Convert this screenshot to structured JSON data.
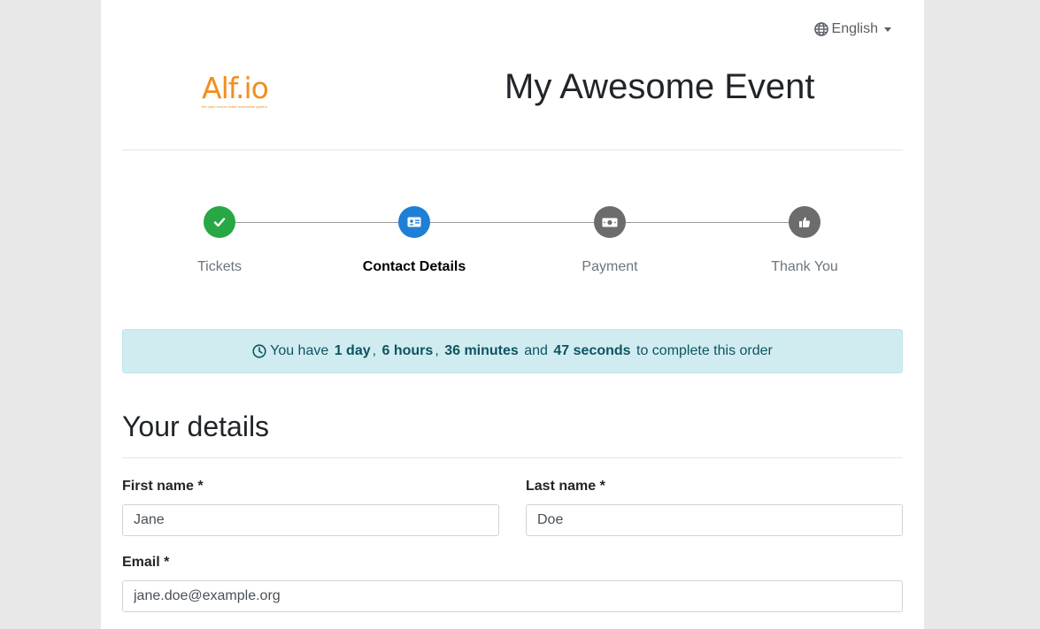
{
  "language": {
    "icon": "globe-icon",
    "label": "English"
  },
  "logo": {
    "text": "Alf.io",
    "tagline": "the open source ticket reservation system",
    "color": "#f28e1e"
  },
  "event": {
    "title": "My Awesome Event"
  },
  "steps": [
    {
      "label": "Tickets",
      "state": "done",
      "icon": "check-icon"
    },
    {
      "label": "Contact Details",
      "state": "active",
      "icon": "id-card-icon"
    },
    {
      "label": "Payment",
      "state": "todo",
      "icon": "money-icon"
    },
    {
      "label": "Thank You",
      "state": "todo",
      "icon": "thumbs-up-icon"
    }
  ],
  "timer": {
    "prefix": "You have",
    "days": "1 day",
    "hours": "6 hours",
    "minutes": "36 minutes",
    "and": "and",
    "seconds": "47 seconds",
    "suffix": "to complete this order"
  },
  "section": {
    "title": "Your details"
  },
  "form": {
    "first_name": {
      "label": "First name *",
      "value": "Jane"
    },
    "last_name": {
      "label": "Last name *",
      "value": "Doe"
    },
    "email": {
      "label": "Email *",
      "value": "jane.doe@example.org"
    }
  },
  "colors": {
    "done": "#28a745",
    "active": "#1f7fd6",
    "todo": "#6c6c6c",
    "alert_bg": "#d1ecf1"
  }
}
